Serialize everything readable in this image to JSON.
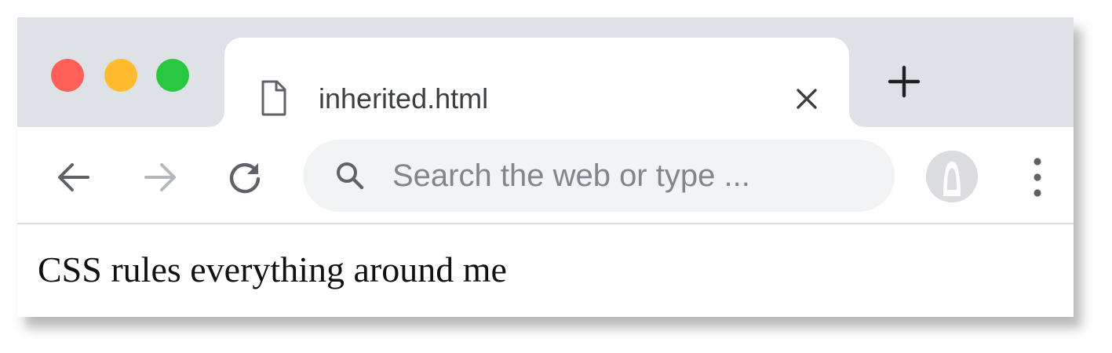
{
  "colors": {
    "close": "#fe5f57",
    "minimize": "#febc2e",
    "zoom": "#28c840",
    "titlebar_bg": "#dee1e6",
    "omnibox_bg": "#f1f3f4",
    "icon": "#5f6368",
    "icon_disabled": "#b4b7bb"
  },
  "window_controls": {
    "close_icon": "close-traffic-light",
    "minimize_icon": "minimize-traffic-light",
    "zoom_icon": "zoom-traffic-light"
  },
  "tab": {
    "title": "inherited.html",
    "icon": "document-icon",
    "close_icon": "close-icon"
  },
  "new_tab": {
    "icon": "plus-icon"
  },
  "toolbar": {
    "back_icon": "arrow-left-icon",
    "forward_icon": "arrow-right-icon",
    "reload_icon": "reload-icon",
    "menu_icon": "kebab-menu-icon",
    "avatar_icon": "profile-avatar"
  },
  "omnibox": {
    "placeholder": "Search the web or type ...",
    "icon": "search-icon"
  },
  "page": {
    "text": "CSS rules everything around me"
  }
}
